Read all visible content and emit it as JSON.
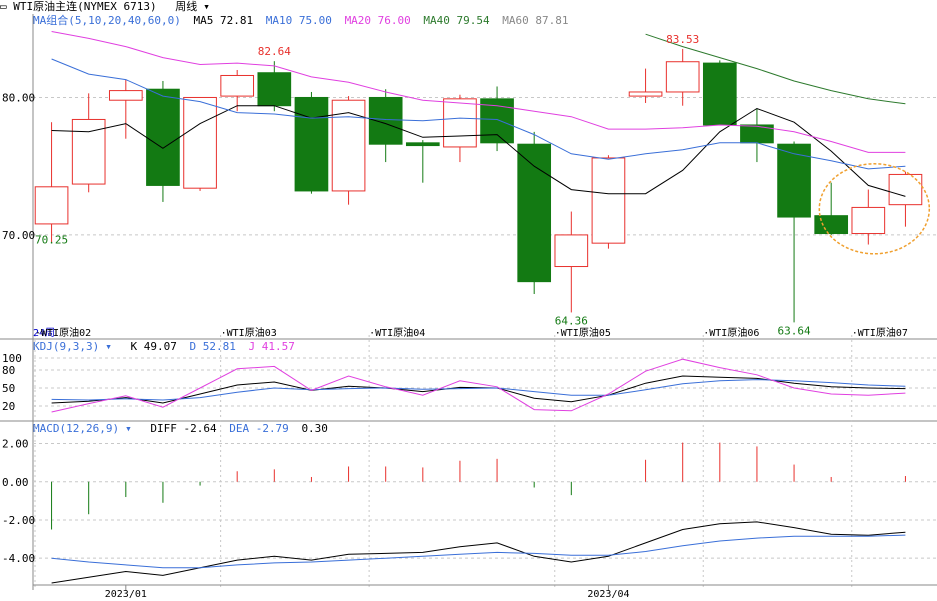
{
  "header": {
    "instrument": "WTI原油主连(NYMEX 6713)",
    "period": "周线",
    "caret": "▾"
  },
  "colors": {
    "up": "#e8302c",
    "down": "#137a13",
    "ma5": "#000000",
    "ma10": "#3a6fd8",
    "ma20": "#e040e0",
    "ma40": "#2d7a2d",
    "ma60": "#888888",
    "grid": "#c8c8c8",
    "highlight": "#f0a030"
  },
  "ma_legend": {
    "title": "MA组合(5,10,20,40,60,0)",
    "ma5": "MA5 72.81",
    "ma10": "MA10 75.00",
    "ma20": "MA20 76.00",
    "ma40": "MA40 79.54",
    "ma60": "MA60 87.81"
  },
  "kdj_legend": {
    "title": "KDJ(9,3,3)",
    "k": "K 49.07",
    "d": "D 52.81",
    "j": "J 41.57"
  },
  "macd_legend": {
    "title": "MACD(12,26,9)",
    "diff": "DIFF -2.64",
    "dea": "DEA -2.79",
    "macd": "0.30"
  },
  "chart_data": [
    {
      "type": "candlestick",
      "panel": "price",
      "ylim": [
        62.5,
        86
      ],
      "yticks": [
        "80.00",
        "70.00"
      ],
      "candles": [
        {
          "o": 70.8,
          "h": 78.2,
          "l": 69.4,
          "c": 73.5
        },
        {
          "o": 73.7,
          "h": 80.3,
          "l": 73.1,
          "c": 78.4
        },
        {
          "o": 79.8,
          "h": 81.3,
          "l": 77.0,
          "c": 80.5
        },
        {
          "o": 80.6,
          "h": 81.2,
          "l": 72.4,
          "c": 73.6
        },
        {
          "o": 73.4,
          "h": 80.0,
          "l": 73.2,
          "c": 80.0
        },
        {
          "o": 80.1,
          "h": 82.0,
          "l": 79.0,
          "c": 81.6
        },
        {
          "o": 81.8,
          "h": 82.64,
          "l": 79.0,
          "c": 79.4
        },
        {
          "o": 80.0,
          "h": 80.4,
          "l": 73.0,
          "c": 73.2
        },
        {
          "o": 73.2,
          "h": 80.1,
          "l": 72.2,
          "c": 79.8
        },
        {
          "o": 80.0,
          "h": 80.6,
          "l": 75.3,
          "c": 76.6
        },
        {
          "o": 76.7,
          "h": 76.9,
          "l": 73.8,
          "c": 76.5
        },
        {
          "o": 76.4,
          "h": 80.2,
          "l": 75.3,
          "c": 79.9
        },
        {
          "o": 79.9,
          "h": 80.8,
          "l": 76.1,
          "c": 76.7
        },
        {
          "o": 76.6,
          "h": 77.5,
          "l": 65.7,
          "c": 66.6
        },
        {
          "o": 67.7,
          "h": 71.7,
          "l": 64.36,
          "c": 70.0
        },
        {
          "o": 69.4,
          "h": 75.8,
          "l": 69.0,
          "c": 75.6
        },
        {
          "o": 80.1,
          "h": 82.1,
          "l": 79.6,
          "c": 80.4
        },
        {
          "o": 80.4,
          "h": 83.53,
          "l": 79.4,
          "c": 82.6
        },
        {
          "o": 82.5,
          "h": 82.7,
          "l": 78.3,
          "c": 78.0
        },
        {
          "o": 78.0,
          "h": 79.2,
          "l": 75.3,
          "c": 76.7
        },
        {
          "o": 76.6,
          "h": 76.8,
          "l": 63.64,
          "c": 71.3
        },
        {
          "o": 71.4,
          "h": 73.8,
          "l": 70.0,
          "c": 70.1
        },
        {
          "o": 70.1,
          "h": 73.3,
          "l": 69.3,
          "c": 72.0
        },
        {
          "o": 72.2,
          "h": 74.6,
          "l": 70.6,
          "c": 74.4
        }
      ],
      "annotations": [
        {
          "label": "82.64",
          "index": 6,
          "value": 82.64,
          "kind": "high"
        },
        {
          "label": "83.53",
          "index": 17,
          "value": 83.53,
          "kind": "high"
        },
        {
          "label": "70.25",
          "index": 0,
          "value": 70.25,
          "kind": "low"
        },
        {
          "label": "64.36",
          "index": 14,
          "value": 64.36,
          "kind": "low"
        },
        {
          "label": "63.64",
          "index": 20,
          "value": 63.64,
          "kind": "low"
        }
      ],
      "series": [
        {
          "name": "MA5",
          "values": [
            77.6,
            77.5,
            78.1,
            76.3,
            78.1,
            79.4,
            79.4,
            78.5,
            78.9,
            78.1,
            77.1,
            77.2,
            77.3,
            75.0,
            73.3,
            73.0,
            73.0,
            74.7,
            77.5,
            79.2,
            78.2,
            76.1,
            73.6,
            72.8
          ]
        },
        {
          "name": "MA10",
          "values": [
            82.8,
            81.7,
            81.3,
            80.1,
            79.7,
            78.9,
            78.8,
            78.5,
            78.6,
            78.4,
            78.3,
            78.5,
            78.4,
            77.3,
            75.9,
            75.5,
            75.9,
            76.2,
            76.7,
            76.7,
            75.9,
            75.4,
            74.8,
            75.0
          ]
        },
        {
          "name": "MA20",
          "values": [
            84.8,
            84.3,
            83.7,
            82.9,
            82.4,
            82.5,
            82.3,
            81.5,
            81.1,
            80.4,
            79.8,
            79.6,
            79.4,
            79.0,
            78.6,
            77.7,
            77.7,
            77.8,
            78.0,
            77.9,
            77.5,
            76.8,
            76.0,
            76.0
          ]
        },
        {
          "name": "MA40",
          "values": [
            null,
            null,
            null,
            null,
            null,
            null,
            null,
            null,
            null,
            null,
            null,
            null,
            null,
            null,
            null,
            null,
            84.6,
            83.7,
            82.9,
            82.1,
            81.2,
            80.5,
            79.9,
            79.54
          ]
        }
      ]
    },
    {
      "type": "line",
      "panel": "KDJ",
      "ylim": [
        0,
        110
      ],
      "yticks": [
        "100",
        "80",
        "50",
        "20"
      ],
      "series": [
        {
          "name": "K",
          "values": [
            25,
            28,
            34,
            25,
            40,
            55,
            60,
            46,
            53,
            50,
            44,
            51,
            50,
            33,
            27,
            38,
            58,
            70,
            68,
            66,
            58,
            52,
            50,
            49.07
          ]
        },
        {
          "name": "D",
          "values": [
            31,
            30,
            32,
            30,
            34,
            43,
            50,
            47,
            49,
            50,
            48,
            49,
            50,
            44,
            38,
            38,
            47,
            57,
            62,
            64,
            62,
            59,
            55,
            52.81
          ]
        },
        {
          "name": "J",
          "values": [
            10,
            24,
            37,
            18,
            50,
            82,
            86,
            46,
            70,
            52,
            38,
            62,
            52,
            14,
            12,
            40,
            78,
            98,
            84,
            72,
            50,
            40,
            38,
            41.57
          ]
        }
      ]
    },
    {
      "type": "bar",
      "panel": "MACD",
      "ylim": [
        -5.3,
        2.5
      ],
      "yticks": [
        "2.00",
        "0.00",
        "-2.00",
        "-4.00"
      ],
      "values": [
        -2.5,
        -1.7,
        -0.8,
        -1.1,
        -0.2,
        0.55,
        0.65,
        0.25,
        0.8,
        0.8,
        0.75,
        1.1,
        1.2,
        -0.3,
        -0.7,
        0.0,
        1.15,
        2.05,
        2.05,
        1.85,
        0.9,
        0.25,
        0.0,
        0.3
      ],
      "series": [
        {
          "name": "DIFF",
          "values": [
            -5.3,
            -5.0,
            -4.7,
            -4.9,
            -4.5,
            -4.1,
            -3.9,
            -4.1,
            -3.8,
            -3.75,
            -3.7,
            -3.4,
            -3.2,
            -3.9,
            -4.2,
            -3.9,
            -3.2,
            -2.5,
            -2.2,
            -2.1,
            -2.4,
            -2.75,
            -2.8,
            -2.64
          ]
        },
        {
          "name": "DEA",
          "values": [
            -4.0,
            -4.2,
            -4.35,
            -4.5,
            -4.5,
            -4.35,
            -4.25,
            -4.2,
            -4.1,
            -4.0,
            -3.9,
            -3.8,
            -3.7,
            -3.75,
            -3.85,
            -3.85,
            -3.65,
            -3.35,
            -3.1,
            -2.95,
            -2.85,
            -2.85,
            -2.85,
            -2.79
          ]
        }
      ]
    }
  ],
  "month_labels": [
    {
      "label": "24周",
      "index": 0
    },
    {
      "label": "·WTI原油02",
      "index": 0
    },
    {
      "label": "·WTI原油03",
      "index": 5
    },
    {
      "label": "·WTI原油04",
      "index": 9
    },
    {
      "label": "·WTI原油05",
      "index": 14
    },
    {
      "label": "·WTI原油06",
      "index": 18
    },
    {
      "label": "·WTI原油07",
      "index": 22
    }
  ],
  "year_labels": [
    {
      "label": "2023/01",
      "index": 2
    },
    {
      "label": "2023/04",
      "index": 15
    }
  ]
}
